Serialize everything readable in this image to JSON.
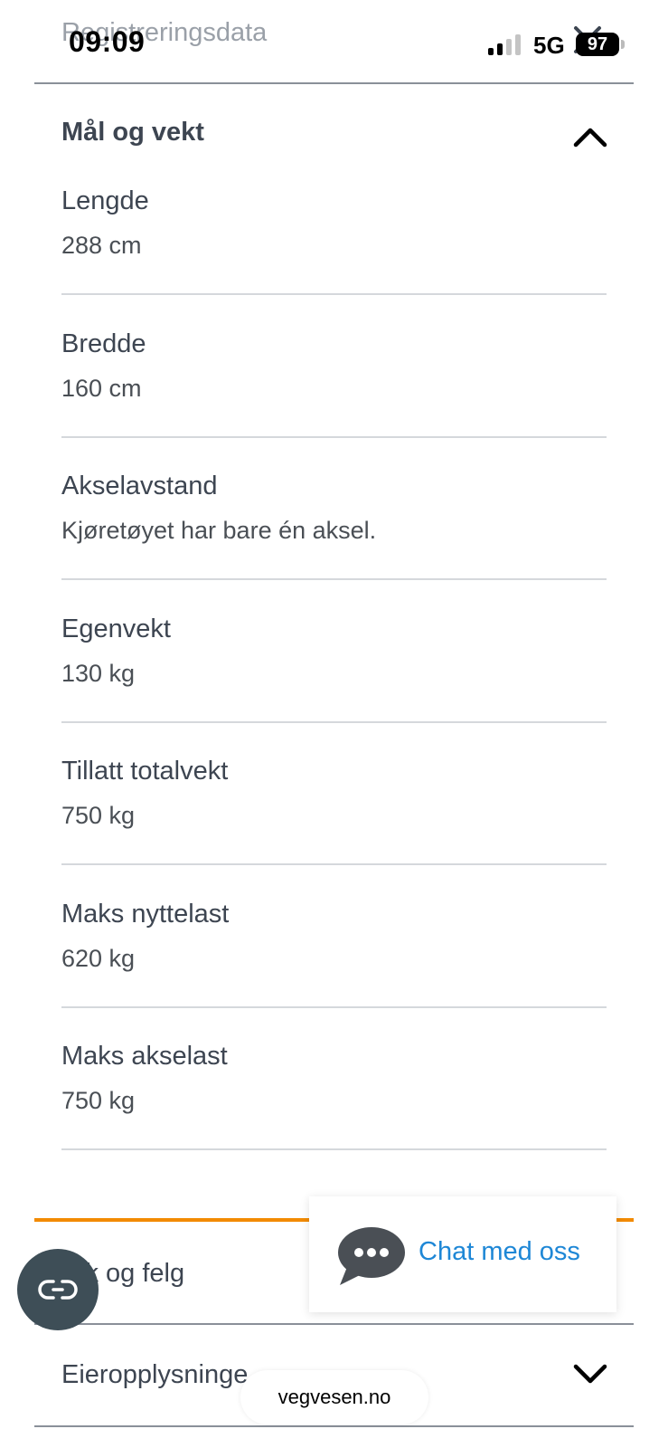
{
  "status_bar": {
    "time": "09:09",
    "network": "5G",
    "battery": "97"
  },
  "header": {
    "previous_section": "Registreringsdata"
  },
  "section": {
    "title": "Mål og vekt",
    "expanded": true
  },
  "rows": [
    {
      "label": "Lengde",
      "value": "288 cm"
    },
    {
      "label": "Bredde",
      "value": "160 cm"
    },
    {
      "label": "Akselavstand",
      "value": "Kjøretøyet har bare én aksel."
    },
    {
      "label": "Egenvekt",
      "value": "130 kg"
    },
    {
      "label": "Tillatt totalvekt",
      "value": "750 kg"
    },
    {
      "label": "Maks nyttelast",
      "value": "620 kg"
    },
    {
      "label": "Maks akselast",
      "value": "750 kg"
    }
  ],
  "collapsed_sections": [
    {
      "title": "Dekk og felg",
      "visible_text": "kk og felg"
    },
    {
      "title": "Eieropplysninger",
      "visible_text": "Eieropplysninge"
    }
  ],
  "chat": {
    "label": "Chat med oss"
  },
  "browser": {
    "url": "vegvesen.no"
  },
  "colors": {
    "accent": "#f28a00",
    "link": "#1e87d6",
    "text": "#3d4551"
  }
}
